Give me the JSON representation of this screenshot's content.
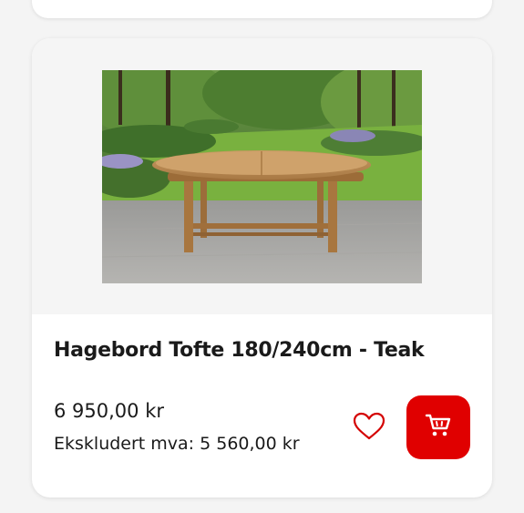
{
  "product": {
    "title": "Hagebord Tofte 180/240cm - Teak",
    "price": "6 950,00 kr",
    "price_ex_vat": "Ekskludert mva: 5 560,00 kr",
    "image_subject": "Oval teak garden table on stone patio with garden background"
  },
  "actions": {
    "favorite_icon": "heart-outline-icon",
    "cart_icon": "shopping-cart-icon"
  },
  "colors": {
    "accent": "#e00000",
    "heart": "#d40000",
    "card_bg": "#ffffff",
    "page_bg": "#f4f4f4"
  }
}
